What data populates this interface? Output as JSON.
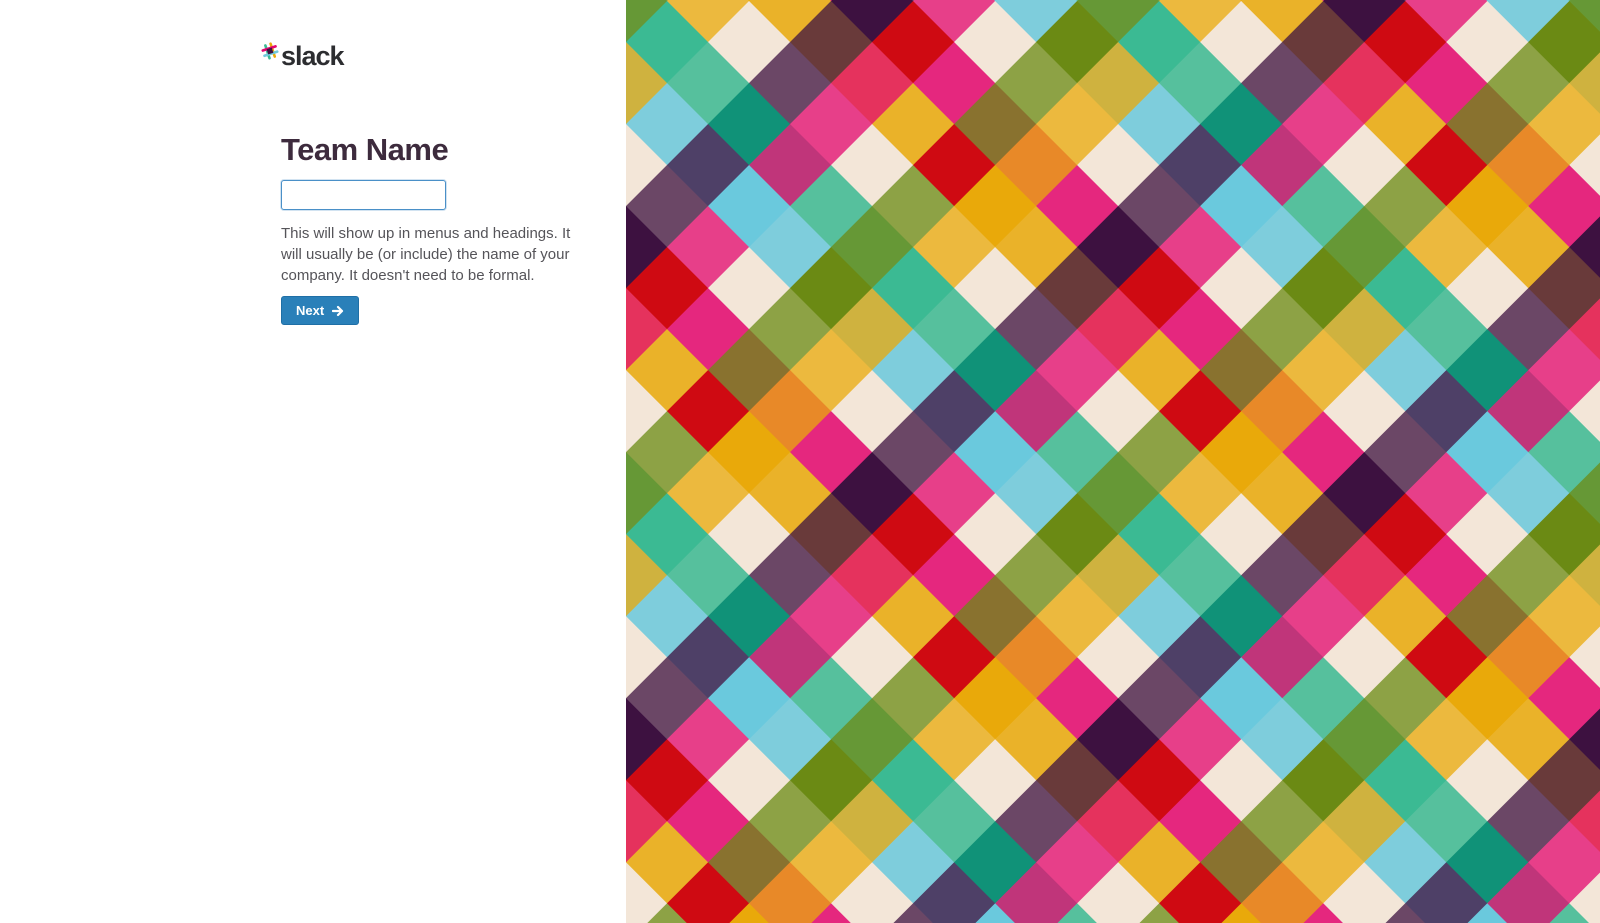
{
  "logo": {
    "text": "slack",
    "icon": "slack-hash-icon"
  },
  "form": {
    "title": "Team Name",
    "input_value": "",
    "help_text": "This will show up in menus and headings. It will usually be (or include) the name of your company. It doesn't need to be formal.",
    "next_label": "Next",
    "next_icon": "arrow-right-icon"
  },
  "colors": {
    "title": "#3d2b3d",
    "button": "#2a80b9",
    "input_border": "#4a90c8",
    "pattern": [
      "#3d1140",
      "#e3066e",
      "#cf0a12",
      "#e9a90a",
      "#6b8a14",
      "#3bba93",
      "#109278",
      "#6ac9dd",
      "#f3e6d8"
    ]
  }
}
